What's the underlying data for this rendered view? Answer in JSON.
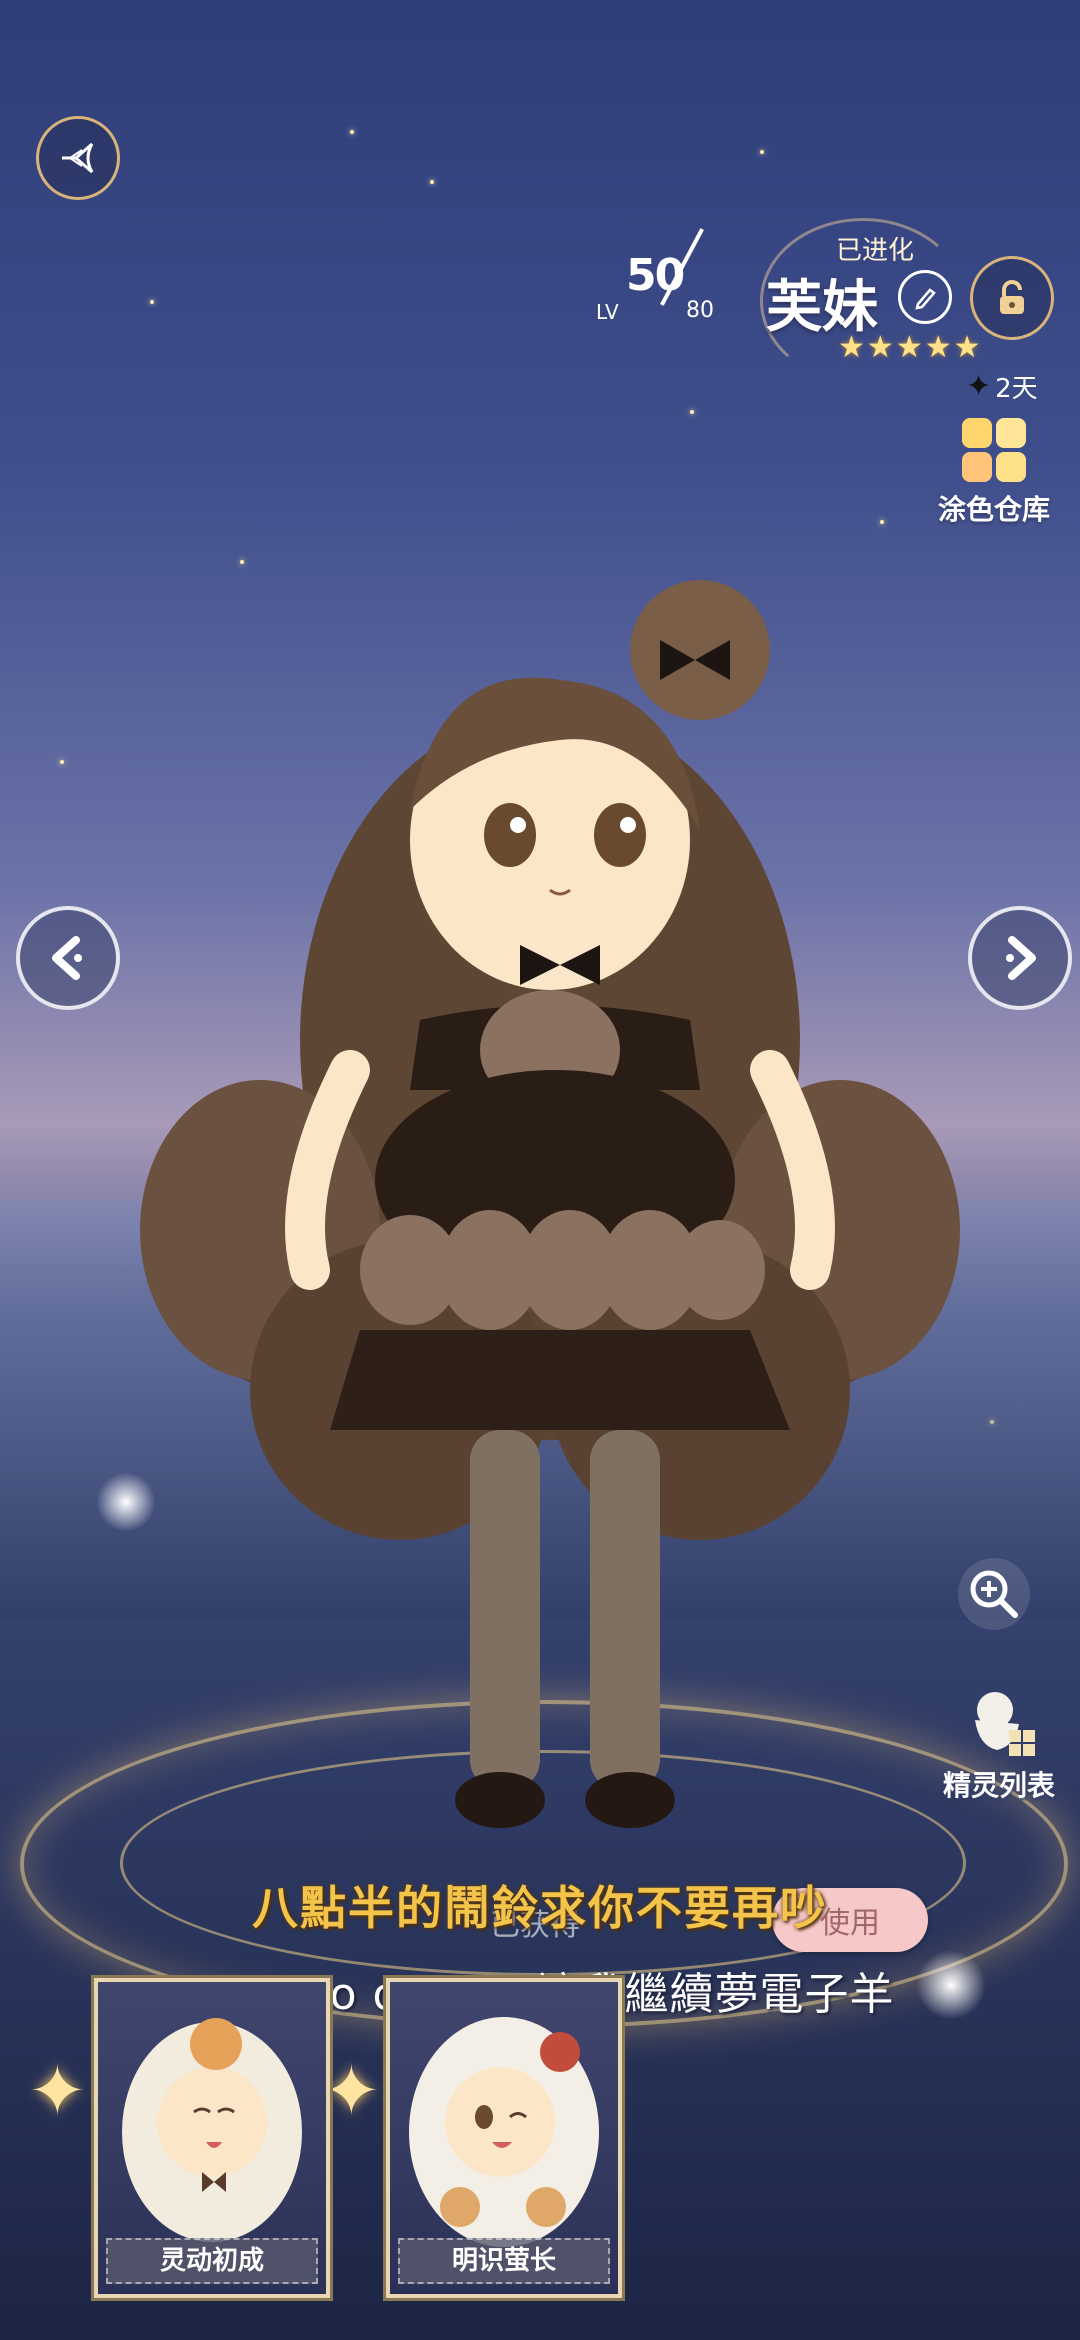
{
  "level": {
    "current": "50",
    "lv_label": "LV",
    "max": "80"
  },
  "pet": {
    "status": "已进化",
    "name": "芙妹",
    "stars": 5
  },
  "timer": {
    "value": "2天"
  },
  "side_buttons": {
    "paint_storage": "涂色仓库",
    "sprite_list": "精灵列表"
  },
  "subtitles": {
    "chinese": "八點半的鬧鈴求你不要再吵",
    "english": "Back to dream 讓我繼續夢電子羊"
  },
  "outfit_actions": {
    "obtained_label": "已获得",
    "use_label": "使用"
  },
  "outfit_cards": [
    {
      "label": "灵动初成"
    },
    {
      "label": "明识萤长"
    }
  ],
  "icons": [
    "back-wing-icon",
    "edit-icon",
    "lock-icon",
    "sparkle-icon",
    "palette-icon",
    "arrow-left-icon",
    "arrow-right-icon",
    "zoom-in-icon",
    "sprite-list-icon"
  ]
}
